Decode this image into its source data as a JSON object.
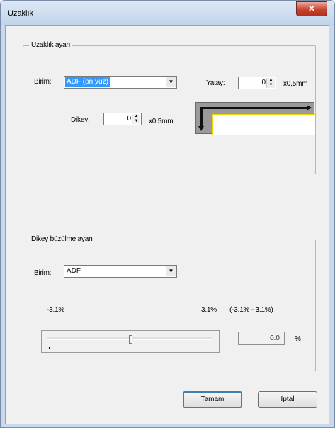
{
  "window": {
    "title": "Uzaklık",
    "close_glyph": "✕"
  },
  "distance_group": {
    "title": "Uzaklık ayarı",
    "unit_label": "Birim:",
    "unit_value": "ADF (ön yüz)",
    "horizontal_label": "Yatay:",
    "horizontal_value": "0",
    "horizontal_unit": "x0,5mm",
    "vertical_label": "Dikey:",
    "vertical_value": "0",
    "vertical_unit": "x0,5mm"
  },
  "shrink_group": {
    "title": "Dikey büzülme ayarı",
    "unit_label": "Birim:",
    "unit_value": "ADF",
    "min_label": "-3.1%",
    "max_label": "3.1%",
    "range_label": "(-3.1% - 3.1%)",
    "slider_min": -3.1,
    "slider_max": 3.1,
    "slider_value": 0.0,
    "value_text": "0.0",
    "value_unit": "%"
  },
  "buttons": {
    "ok": "Tamam",
    "cancel": "İptal"
  },
  "icons": {
    "dropdown_arrow": "▼",
    "spin_up": "▲",
    "spin_down": "▼"
  },
  "colors": {
    "selection": "#3399ff",
    "close_button": "#c7432f",
    "window_frame": "#c9d8ec"
  }
}
